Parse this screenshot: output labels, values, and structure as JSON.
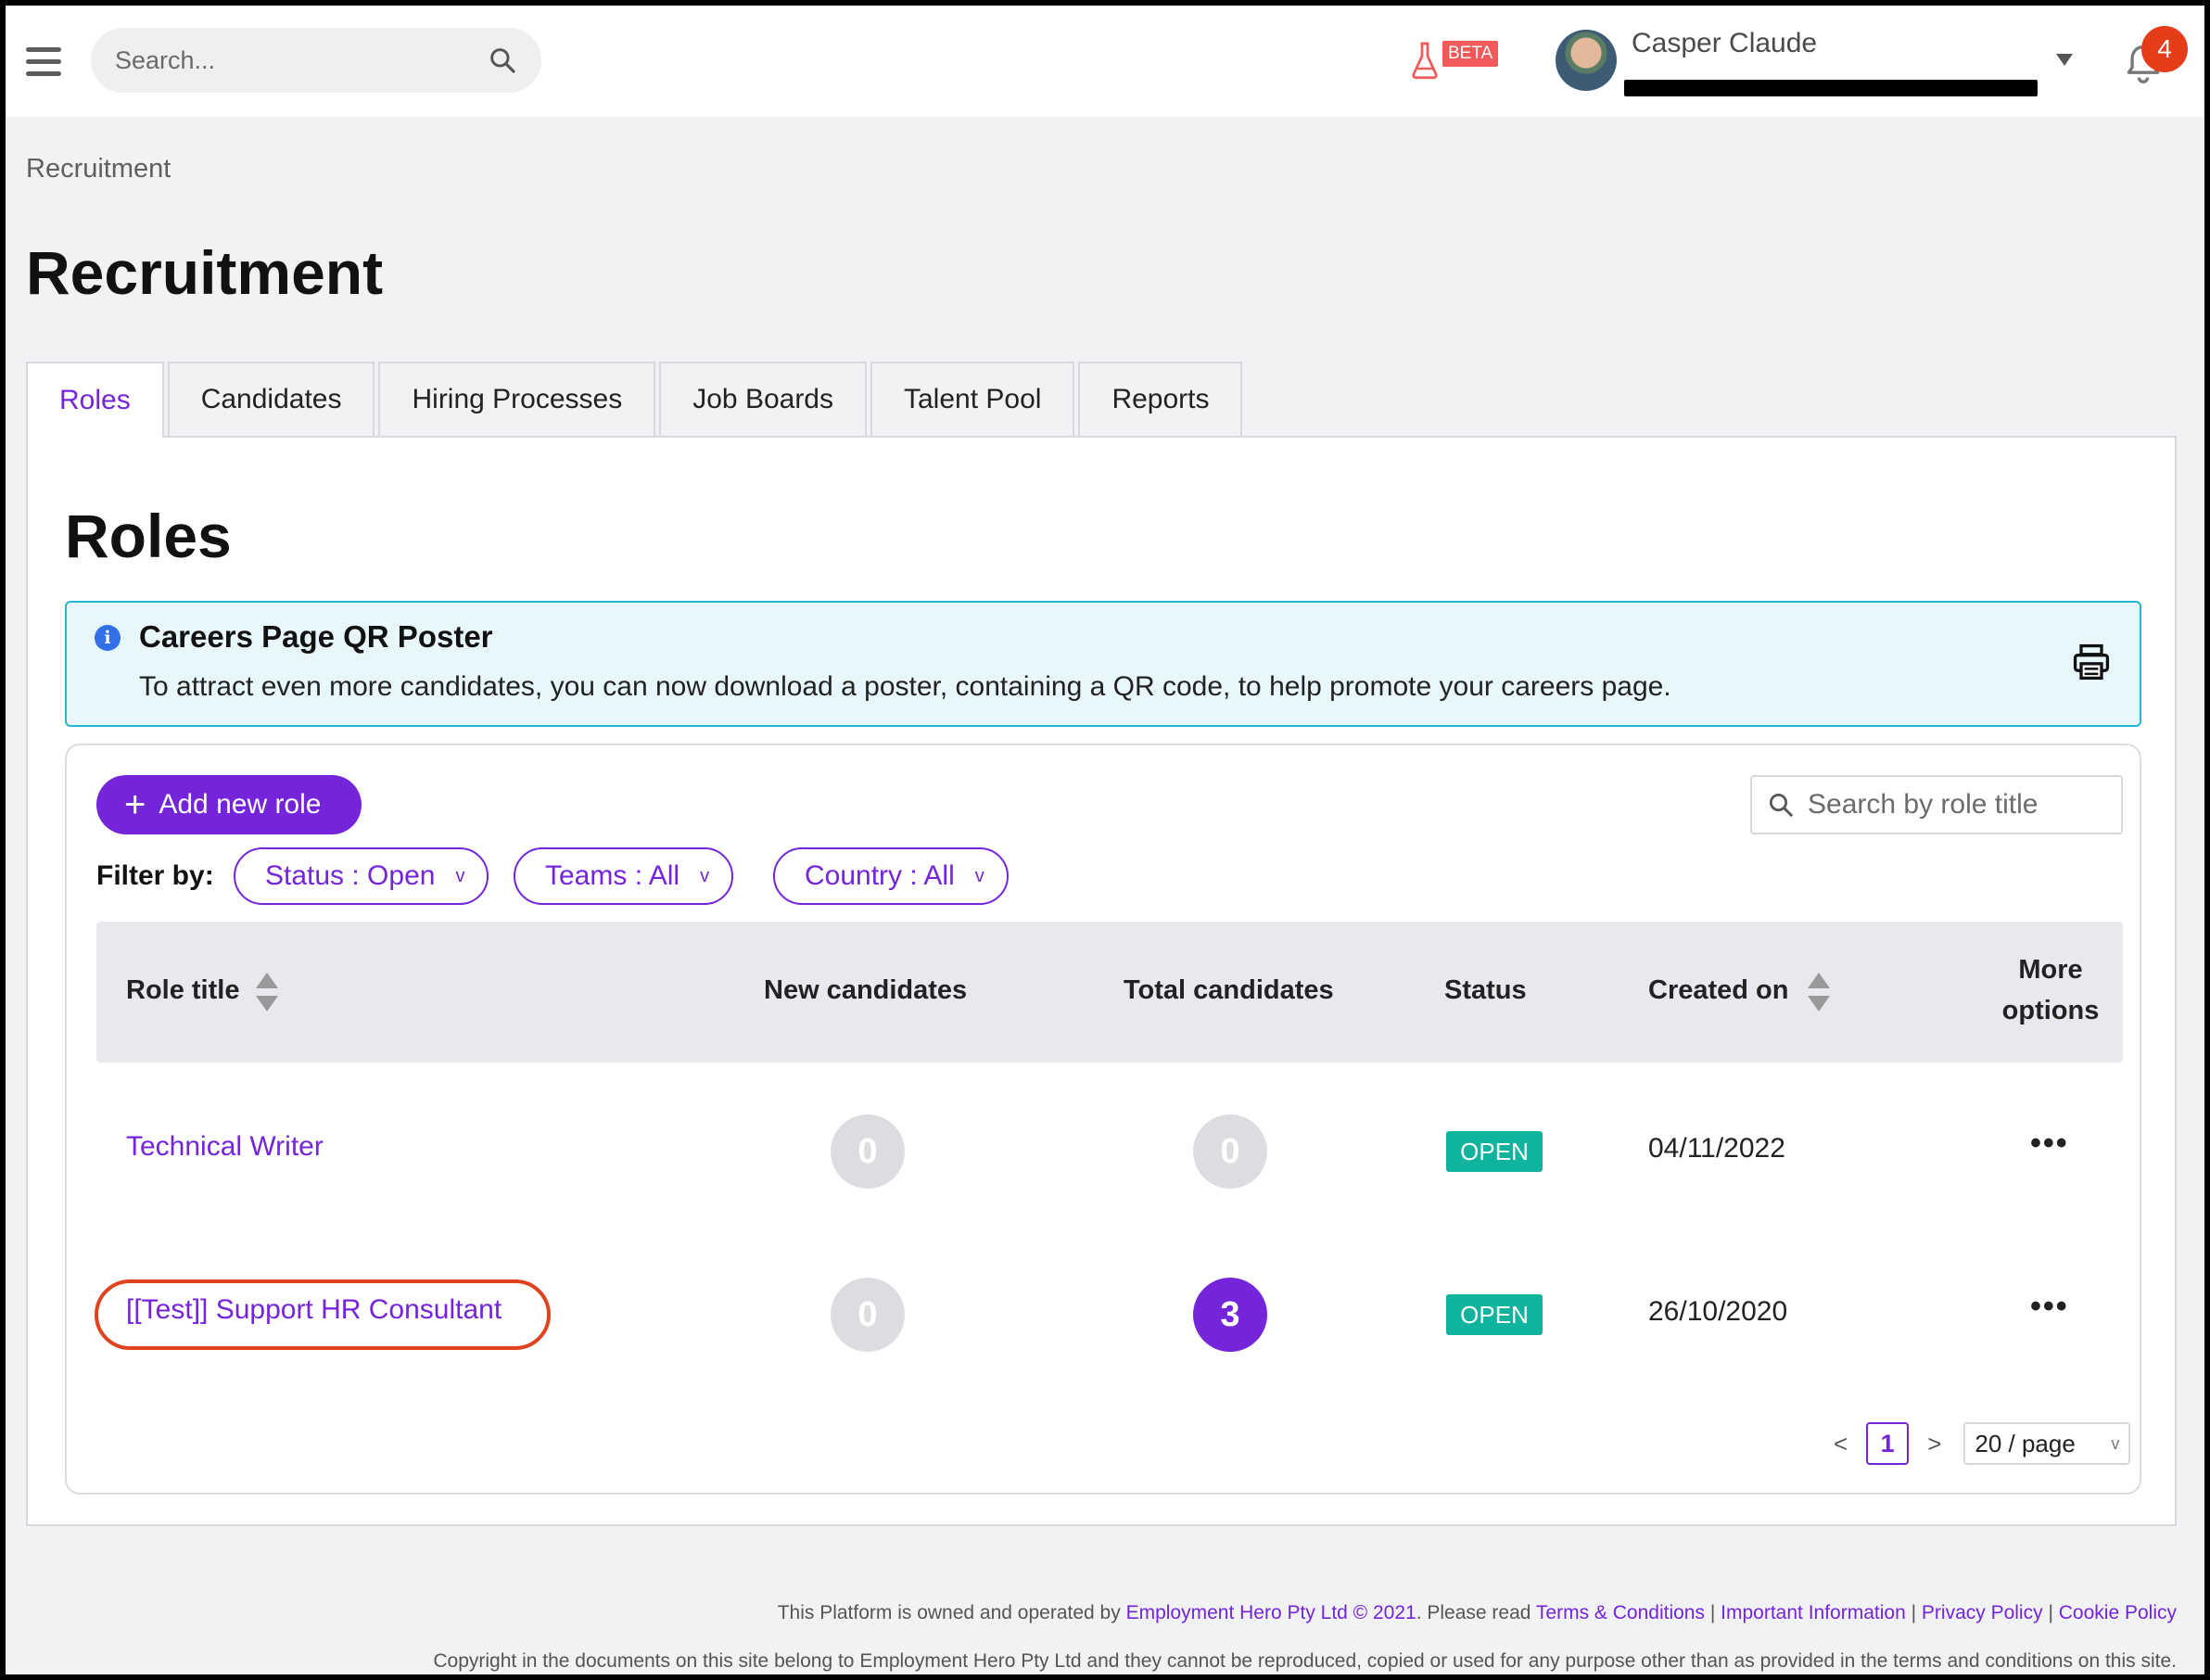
{
  "header": {
    "search_placeholder": "Search...",
    "beta_label": "BETA",
    "user_name": "Casper Claude",
    "notification_count": "4"
  },
  "breadcrumb": "Recruitment",
  "page_title": "Recruitment",
  "tabs": [
    {
      "label": "Roles",
      "active": true
    },
    {
      "label": "Candidates",
      "active": false
    },
    {
      "label": "Hiring Processes",
      "active": false
    },
    {
      "label": "Job Boards",
      "active": false
    },
    {
      "label": "Talent Pool",
      "active": false
    },
    {
      "label": "Reports",
      "active": false
    }
  ],
  "section_title": "Roles",
  "info": {
    "title": "Careers Page QR Poster",
    "text": "To attract even more candidates, you can now download a poster, containing a QR code, to help promote your careers page.",
    "icon_letter": "i"
  },
  "actions": {
    "add_role_plus": "+",
    "add_role": "Add new role",
    "role_search_placeholder": "Search by role title",
    "filter_label": "Filter by:",
    "filters": [
      "Status : Open",
      "Teams : All",
      "Country : All"
    ],
    "filter_chevron": "v"
  },
  "table": {
    "columns": {
      "role_title": "Role title",
      "new_candidates": "New candidates",
      "total_candidates": "Total candidates",
      "status": "Status",
      "created_on": "Created on",
      "more_options_1": "More",
      "more_options_2": "options"
    },
    "rows": [
      {
        "role_title": "Technical Writer",
        "new_candidates": "0",
        "total_candidates": "0",
        "status": "OPEN",
        "created_on": "04/11/2022",
        "more": "•••"
      },
      {
        "role_title": "[[Test]] Support HR Consultant",
        "new_candidates": "0",
        "total_candidates": "3",
        "status": "OPEN",
        "created_on": "26/10/2020",
        "more": "•••"
      }
    ]
  },
  "pagination": {
    "prev": "<",
    "current_page": "1",
    "next": ">",
    "per_page": "20 / page",
    "per_page_chevron": "v"
  },
  "footer": {
    "owned_text": "This Platform is owned and operated by",
    "company_link": "Employment Hero Pty Ltd © 2021",
    "please_read": ". Please read",
    "terms": "Terms & Conditions",
    "sep": "|",
    "important": "Important Information",
    "privacy": "Privacy Policy",
    "cookie": "Cookie Policy",
    "copyright": "Copyright in the documents on this site belong to Employment Hero Pty Ltd and they cannot be reproduced, copied or used for any purpose other than as provided in the terms and conditions on this site."
  },
  "colors": {
    "accent": "#7424d9",
    "status_open": "#0fb39e",
    "info_border": "#24b6d3",
    "info_bg": "#e7f7fc",
    "highlight": "#e0421d",
    "notification": "#e53c1a"
  }
}
